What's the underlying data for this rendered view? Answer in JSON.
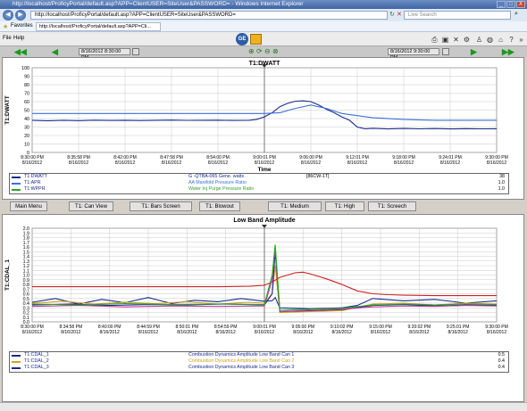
{
  "window": {
    "title": "http://localhost/ProficyPortal/default.asp?APP=ClientUSER=SiteUser&PASSWORD= - Windows Internet Explorer",
    "min": "_",
    "max": "□",
    "close": "X"
  },
  "address": {
    "url": "http://localhost/ProficyPortal/default.asp?APP=ClientUSER=SiteUser&PASSWORD=",
    "search_placeholder": "Live Search"
  },
  "favorites": {
    "label": "Favorites",
    "tab_title": "http://localhost/ProficyPortal/default.asp?APP=Cli..."
  },
  "menu": {
    "file": "File",
    "help": "Help"
  },
  "toolbar": {
    "start_date": "8/16/2012 8:30:00 PM",
    "end_date": "8/16/2012 9:30:00 PM"
  },
  "buttons": {
    "main_menu": "Main Menu",
    "can_view": "T1: Can View",
    "bars_screen": "T1: Bars Screen",
    "blowout": "T1: Blowout",
    "medium": "T1: Medium",
    "high": "T1: High",
    "screech": "T1: Screech"
  },
  "chart1_legend": [
    {
      "tag": "T1:DWATT",
      "desc": "G -QTBA-065 Gene. watts",
      "unit": "[86CW-1T]",
      "value": "38",
      "color": "#1a2a8c"
    },
    {
      "tag": "T1:APR",
      "desc": "AA Manifold Pressure Ratio",
      "unit": "",
      "value": "1.0",
      "color": "#3a6fd8"
    },
    {
      "tag": "T1:WPPR",
      "desc": "Water Inj Purge Pressure Ratio",
      "unit": "",
      "value": "1.0",
      "color": "#2ea02e"
    }
  ],
  "chart2_legend": [
    {
      "tag": "T1:CDAL_1",
      "desc": "Combustion Dynamics Amplitude Low Band Can 1",
      "value": "0.5",
      "color": "#1a2a8c"
    },
    {
      "tag": "T1:CDAL_2",
      "desc": "Combustion Dynamics Amplitude Low Band Can 2",
      "value": "0.4",
      "color": "#d4a020"
    },
    {
      "tag": "T1:CDAL_3",
      "desc": "Combustion Dynamics Amplitude Low Band Can 3",
      "value": "0.4",
      "color": "#1a2a8c"
    }
  ],
  "chart_data": [
    {
      "type": "line",
      "title": "T1:DWATT",
      "xlabel": "Time",
      "ylabel": "T1:DWATT",
      "ylim": [
        0,
        100
      ],
      "yticks": [
        "100",
        "90",
        "80",
        "70",
        "60",
        "50",
        "40",
        "30",
        "20",
        "10",
        "0"
      ],
      "xticks": [
        [
          "8:30:00 PM",
          "8/16/2012"
        ],
        [
          "8:35:58 PM",
          "8/16/2012"
        ],
        [
          "8:42:00 PM",
          "8/16/2012"
        ],
        [
          "8:47:58 PM",
          "8/16/2012"
        ],
        [
          "8:54:00 PM",
          "8/16/2012"
        ],
        [
          "9:00:01 PM",
          "8/16/2012"
        ],
        [
          "9:06:00 PM",
          "8/16/2012"
        ],
        [
          "9:12:01 PM",
          "8/16/2012"
        ],
        [
          "9:18:00 PM",
          "8/16/2012"
        ],
        [
          "9:24:01 PM",
          "8/16/2012"
        ],
        [
          "9:30:00 PM",
          "8/16/2012"
        ]
      ],
      "grid": true,
      "series": [
        {
          "name": "T1:DWATT",
          "color": "#1a2a8c",
          "x": [
            0,
            2,
            4,
            6,
            8,
            10,
            12,
            14,
            16,
            18,
            20,
            22,
            24,
            26,
            28,
            29,
            30,
            31,
            32,
            33,
            34,
            35,
            36,
            37,
            38,
            39,
            40,
            41,
            42,
            43,
            44,
            46,
            48,
            50,
            52,
            54,
            56,
            58,
            60
          ],
          "y": [
            38,
            37.5,
            38,
            37.6,
            38.1,
            37.8,
            38,
            37.7,
            38,
            38.2,
            37.9,
            38,
            38.1,
            37.8,
            38,
            39,
            42,
            47,
            54,
            58,
            60.5,
            61,
            60,
            56,
            51,
            47,
            42,
            38,
            30,
            28,
            28.5,
            27.8,
            28.3,
            27.9,
            28.2,
            27.8,
            28.1,
            27.9,
            28
          ]
        },
        {
          "name": "T1:APR",
          "color": "#3a6fd8",
          "x": [
            0,
            10,
            20,
            30,
            32,
            34,
            36,
            38,
            40,
            44,
            48,
            52,
            56,
            60
          ],
          "y": [
            46,
            46,
            46,
            46,
            47,
            52,
            56,
            52,
            46,
            41,
            39,
            38,
            38,
            38
          ]
        }
      ]
    },
    {
      "type": "line",
      "title": "Low Band Amplitude",
      "ylabel": "T1:CDAL_1",
      "ylim": [
        0,
        2
      ],
      "yticks": [
        "2.0",
        "1.9",
        "1.8",
        "1.7",
        "1.6",
        "1.5",
        "1.4",
        "1.3",
        "1.2",
        "1.1",
        "1.0",
        "0.9",
        "0.8",
        "0.7",
        "0.6",
        "0.5",
        "0.4",
        "0.3",
        "0.2",
        "0.1",
        "0.0"
      ],
      "xticks": [
        [
          "8:30:00 PM",
          "8/16/2012"
        ],
        [
          "8:34:58 PM",
          "8/16/2012"
        ],
        [
          "8:40:00 PM",
          "8/16/2012"
        ],
        [
          "8:44:59 PM",
          "8/16/2012"
        ],
        [
          "8:50:01 PM",
          "8/16/2012"
        ],
        [
          "8:54:59 PM",
          "8/16/2012"
        ],
        [
          "9:00:01 PM",
          "8/16/2012"
        ],
        [
          "9:05:00 PM",
          "8/16/2012"
        ],
        [
          "9:10:02 PM",
          "8/16/2012"
        ],
        [
          "9:15:00 PM",
          "8/16/2012"
        ],
        [
          "9:20:02 PM",
          "8/16/2012"
        ],
        [
          "9:25:01 PM",
          "8/16/2012"
        ],
        [
          "9:30:00 PM",
          "8/16/2012"
        ]
      ],
      "grid": true,
      "series": [
        {
          "name": "T1:CDAL_1",
          "color": "#1a2a8c",
          "x": [
            0,
            3,
            6,
            9,
            12,
            15,
            18,
            21,
            24,
            27,
            30,
            31,
            31.4,
            32,
            36,
            40,
            42,
            44,
            48,
            52,
            56,
            60
          ],
          "y": [
            0.42,
            0.5,
            0.38,
            0.48,
            0.41,
            0.52,
            0.39,
            0.46,
            0.43,
            0.5,
            0.44,
            0.45,
            0.52,
            0.3,
            0.28,
            0.3,
            0.35,
            0.5,
            0.45,
            0.48,
            0.4,
            0.45
          ]
        },
        {
          "name": "T1:CDAL_2",
          "color": "#d4a020",
          "x": [
            0,
            4,
            8,
            12,
            16,
            20,
            24,
            28,
            30,
            31,
            31.4,
            32,
            36,
            40,
            44,
            48,
            52,
            56,
            60
          ],
          "y": [
            0.4,
            0.44,
            0.38,
            0.42,
            0.39,
            0.43,
            0.38,
            0.42,
            0.4,
            0.6,
            1.2,
            0.2,
            0.22,
            0.24,
            0.38,
            0.4,
            0.36,
            0.4,
            0.38
          ]
        },
        {
          "name": "T1:CDAL_3",
          "color": "#1a2a8c",
          "x": [
            0,
            5,
            10,
            15,
            20,
            25,
            30,
            31,
            31.4,
            32,
            36,
            40,
            44,
            48,
            52,
            56,
            60
          ],
          "y": [
            0.36,
            0.38,
            0.35,
            0.37,
            0.36,
            0.38,
            0.36,
            0.6,
            1.5,
            0.22,
            0.24,
            0.26,
            0.35,
            0.37,
            0.34,
            0.36,
            0.35
          ]
        },
        {
          "name": "",
          "color": "#d02020",
          "x": [
            0,
            4,
            8,
            12,
            16,
            20,
            24,
            28,
            30,
            31,
            32,
            34,
            35,
            36,
            38,
            40,
            42,
            44,
            46,
            48,
            52,
            56,
            60
          ],
          "y": [
            0.75,
            0.75,
            0.75,
            0.75,
            0.75,
            0.75,
            0.75,
            0.76,
            0.78,
            0.85,
            0.95,
            1.05,
            1.06,
            1.02,
            0.92,
            0.8,
            0.66,
            0.6,
            0.58,
            0.57,
            0.56,
            0.56,
            0.56
          ]
        },
        {
          "name": "",
          "color": "#cc33aa",
          "x": [
            0,
            6,
            12,
            18,
            24,
            30,
            31,
            31.4,
            32,
            36,
            40,
            44,
            48,
            52,
            56,
            60
          ],
          "y": [
            0.33,
            0.35,
            0.32,
            0.34,
            0.33,
            0.34,
            0.9,
            1.6,
            0.22,
            0.25,
            0.27,
            0.32,
            0.34,
            0.33,
            0.35,
            0.34
          ]
        },
        {
          "name": "",
          "color": "#22aa22",
          "x": [
            0,
            6,
            12,
            18,
            24,
            30,
            31,
            31.4,
            32,
            36,
            40,
            44,
            48,
            52,
            56,
            60
          ],
          "y": [
            0.38,
            0.36,
            0.39,
            0.37,
            0.38,
            0.37,
            1.0,
            1.65,
            0.25,
            0.27,
            0.29,
            0.36,
            0.38,
            0.36,
            0.38,
            0.37
          ]
        }
      ]
    }
  ]
}
